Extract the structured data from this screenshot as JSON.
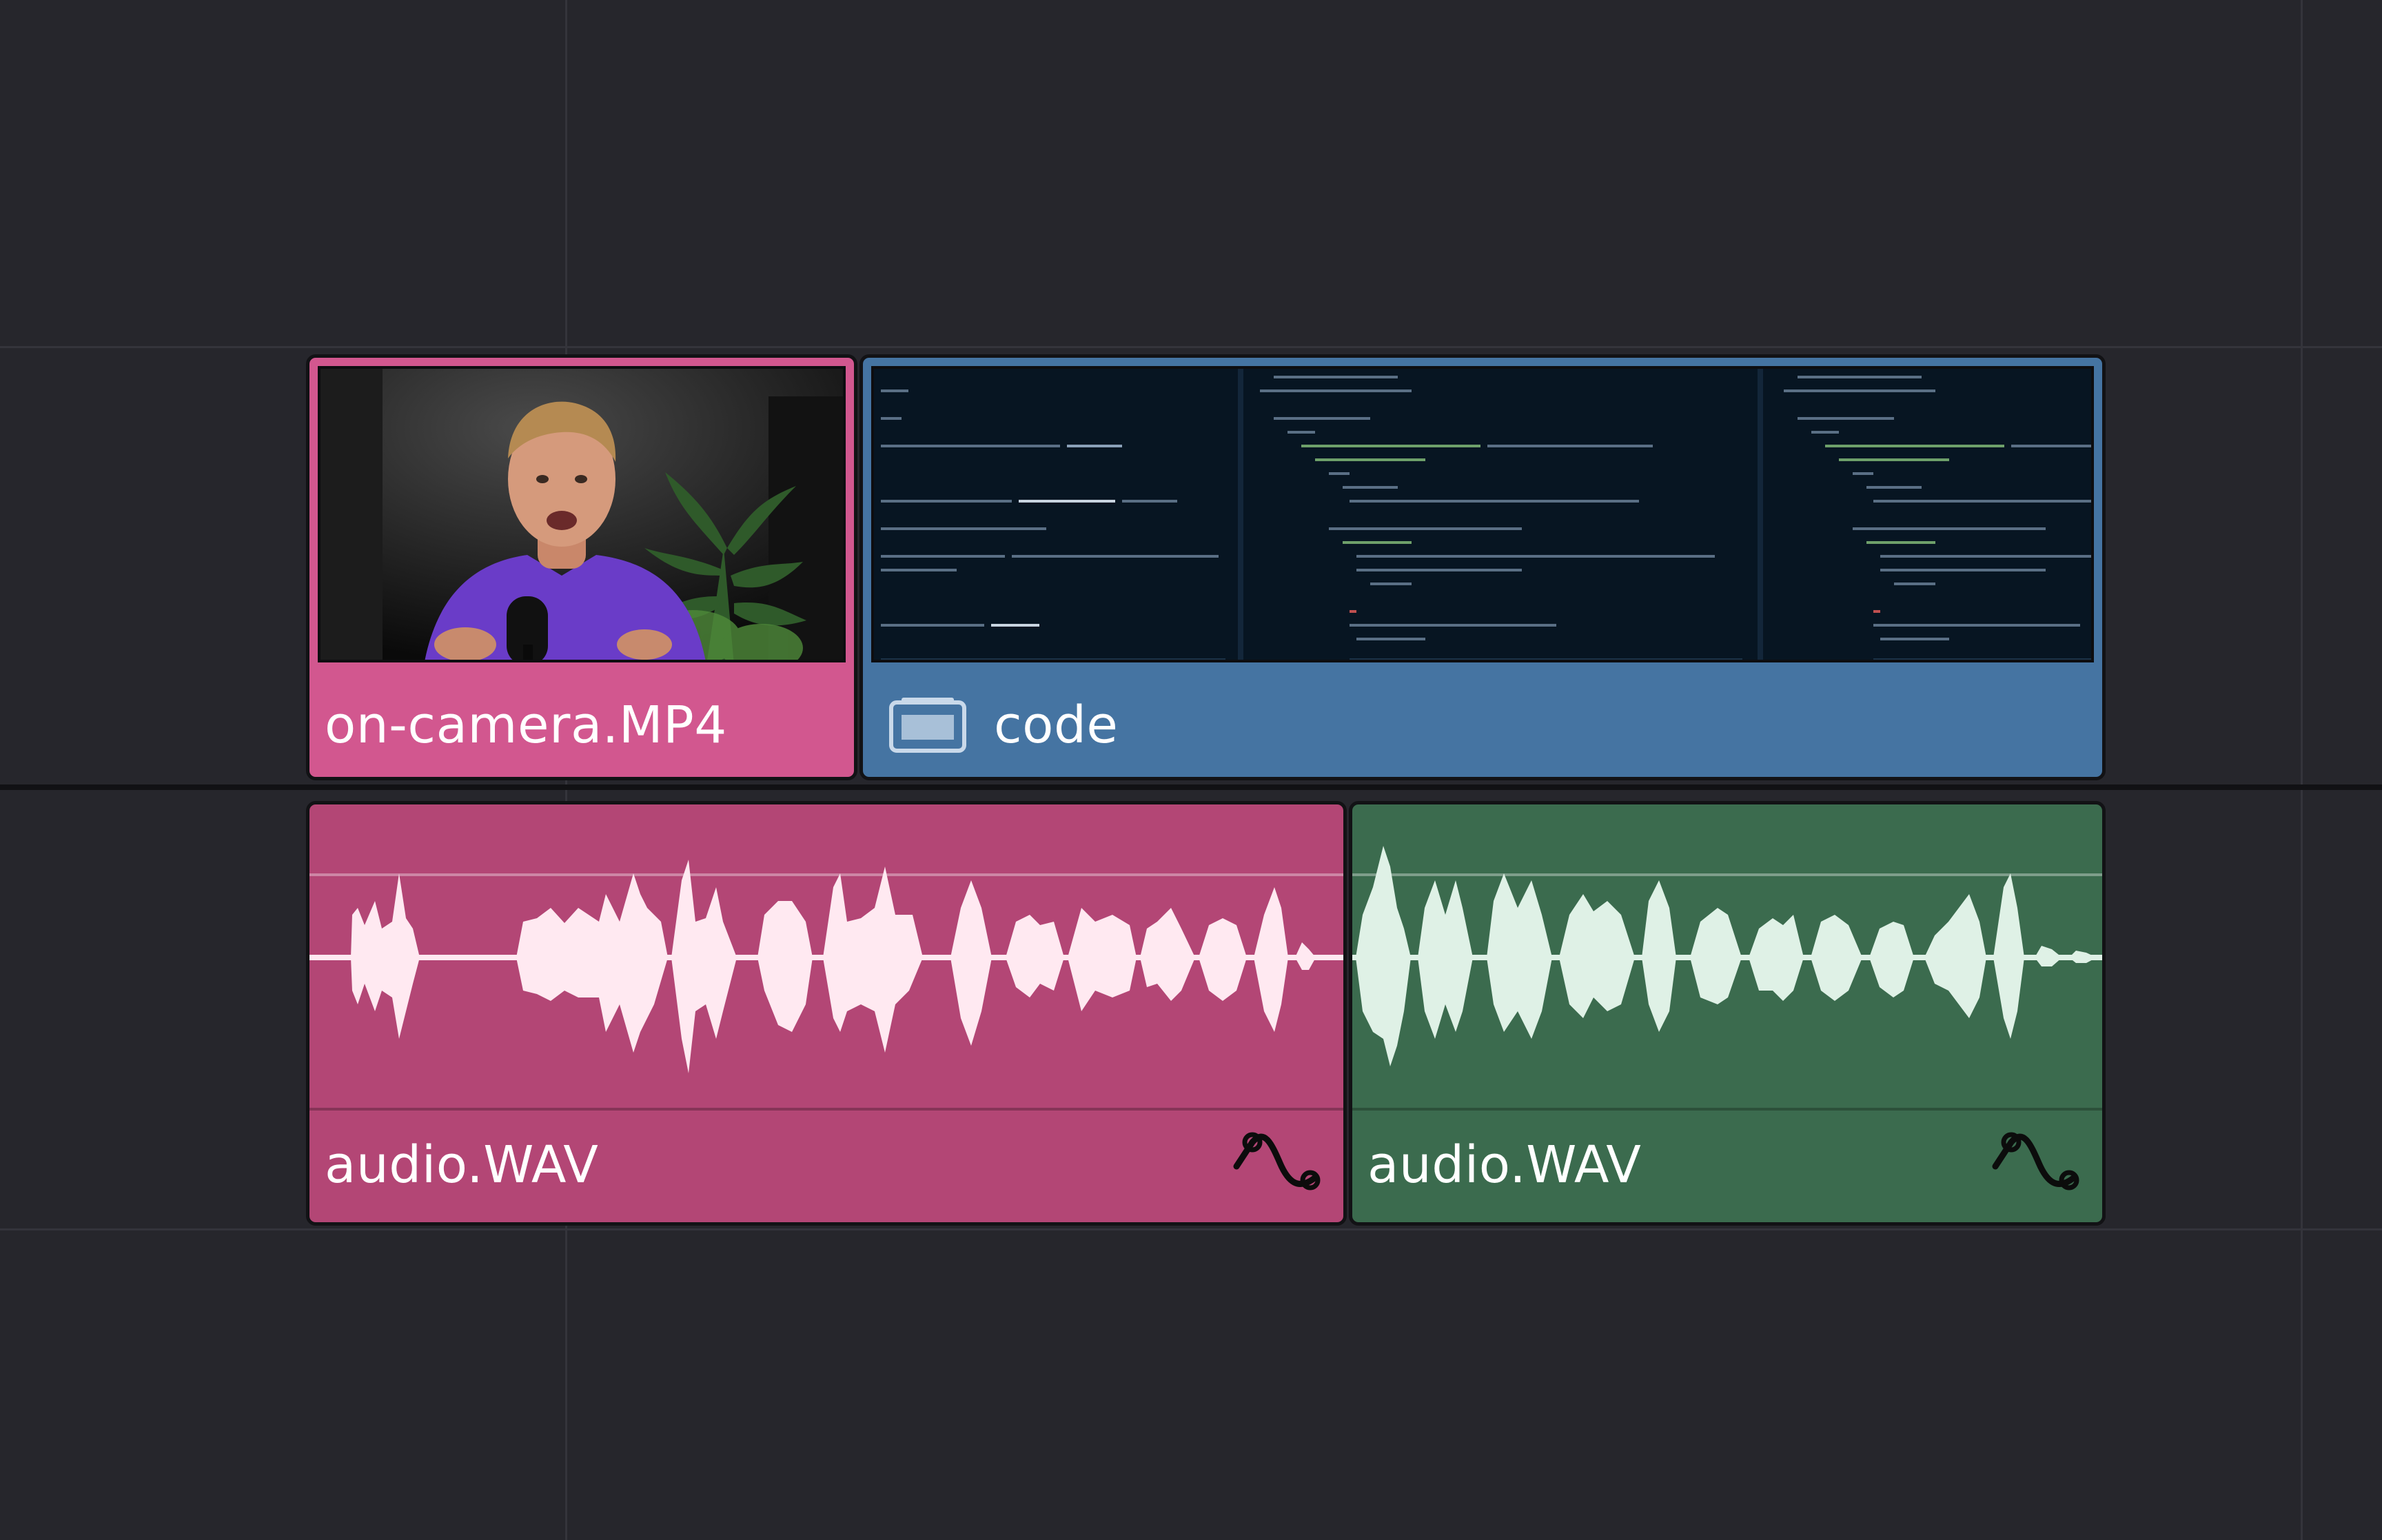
{
  "timeline": {
    "video_clips": [
      {
        "name": "on-camera.MP4",
        "color": "#d2578f",
        "thumbnail": "person-speaking-video"
      },
      {
        "name": "code",
        "color": "#4574a2",
        "thumbnail": "code-editor-screenshot",
        "icon": "compound-clip-icon"
      }
    ],
    "audio_clips": [
      {
        "name": "audio.WAV",
        "color": "#b34675",
        "wave_color": "#ffe9f1",
        "icon": "keyframe-curve-icon"
      },
      {
        "name": "audio.WAV",
        "color": "#3b6b4e",
        "wave_color": "#dff1e6",
        "icon": "keyframe-curve-icon"
      }
    ]
  }
}
